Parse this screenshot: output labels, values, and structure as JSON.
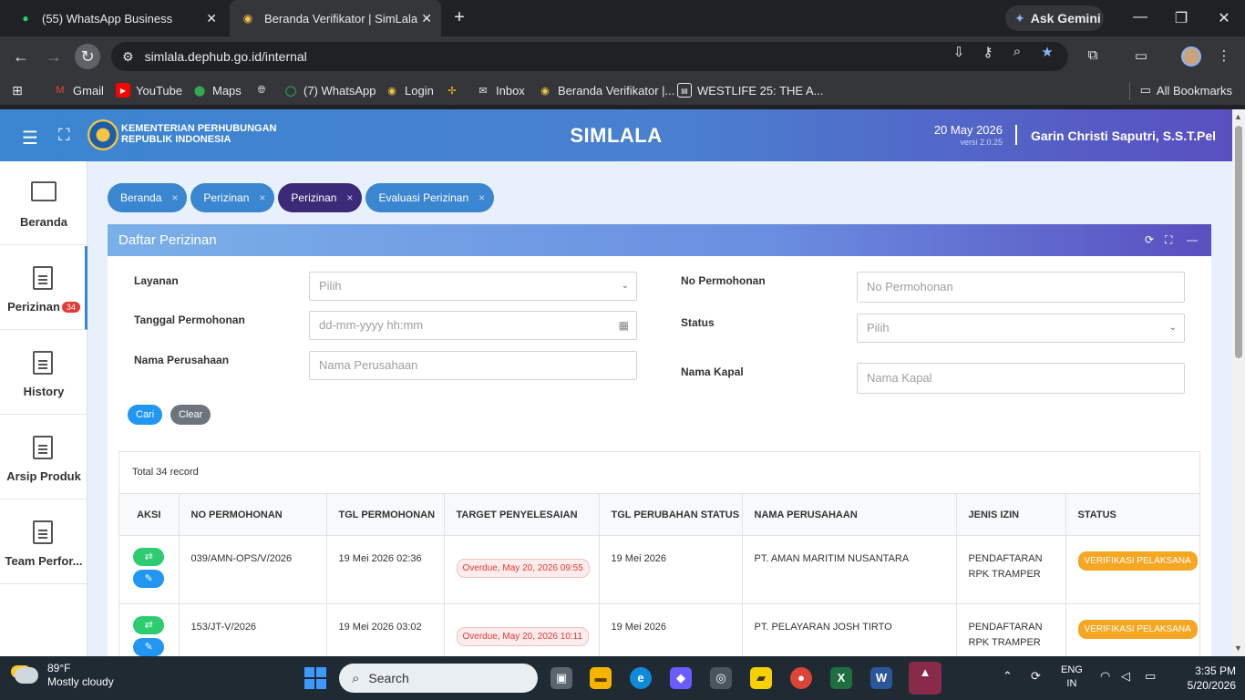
{
  "browser": {
    "tabs": [
      {
        "title": "(55) WhatsApp Business",
        "icon": "whatsapp-icon"
      },
      {
        "title": "Beranda Verifikator | SimLala",
        "icon": "ministry-logo-icon"
      }
    ],
    "ask_gemini": "Ask Gemini",
    "url": "simlala.dephub.go.id/internal",
    "bookmarks": [
      {
        "label": "Gmail",
        "icon": "gmail-icon"
      },
      {
        "label": "YouTube",
        "icon": "youtube-icon"
      },
      {
        "label": "Maps",
        "icon": "maps-icon"
      },
      {
        "label": "",
        "icon": "globe-icon"
      },
      {
        "label": "(7) WhatsApp",
        "icon": "whatsapp-icon"
      },
      {
        "label": "Login",
        "icon": "ministry-logo-icon"
      },
      {
        "label": "",
        "icon": "pinwheel-icon"
      },
      {
        "label": "Inbox",
        "icon": "mail-icon"
      },
      {
        "label": "Beranda Verifikator |...",
        "icon": "ministry-logo-icon"
      },
      {
        "label": "WESTLIFE 25: THE A...",
        "icon": "page-icon"
      }
    ],
    "all_bookmarks": "All Bookmarks"
  },
  "app": {
    "ministry_line1": "KEMENTERIAN PERHUBUNGAN",
    "ministry_line2": "REPUBLIK INDONESIA",
    "name": "SIMLALA",
    "date": "20 May 2026",
    "version": "versi 2.0.25",
    "user": "Garin Christi Saputri, S.S.T.Pel"
  },
  "sidebar": {
    "items": [
      {
        "label": "Beranda",
        "icon": "monitor-icon"
      },
      {
        "label": "Perizinan",
        "icon": "document-icon",
        "badge": "34"
      },
      {
        "label": "History",
        "icon": "document-icon"
      },
      {
        "label": "Arsip Produk",
        "icon": "document-icon"
      },
      {
        "label": "Team Perfor...",
        "icon": "document-icon"
      }
    ]
  },
  "breadcrumbs": [
    "Beranda",
    "Perizinan",
    "Perizinan",
    "Evaluasi Perizinan"
  ],
  "panel": {
    "title": "Daftar Perizinan",
    "filters": {
      "layanan_label": "Layanan",
      "layanan_value": "Pilih",
      "tanggal_label": "Tanggal Permohonan",
      "tanggal_placeholder": "dd-mm-yyyy hh:mm",
      "perusahaan_label": "Nama Perusahaan",
      "perusahaan_placeholder": "Nama Perusahaan",
      "no_label": "No Permohonan",
      "no_placeholder": "No Permohonan",
      "status_label": "Status",
      "status_value": "Pilih",
      "kapal_label": "Nama Kapal",
      "kapal_placeholder": "Nama Kapal"
    },
    "cari": "Cari",
    "clear": "Clear",
    "total": "Total 34 record",
    "columns": [
      "AKSI",
      "NO PERMOHONAN",
      "TGL PERMOHONAN",
      "TARGET PENYELESAIAN",
      "TGL PERUBAHAN STATUS",
      "NAMA PERUSAHAAN",
      "JENIS IZIN",
      "STATUS"
    ],
    "rows": [
      {
        "no": "039/AMN-OPS/V/2026",
        "tgl": "19 Mei 2026 02:36",
        "target": "Overdue, May 20, 2026 09:55",
        "perubahan": "19 Mei 2026",
        "perusahaan": "PT. AMAN MARITIM NUSANTARA",
        "jenis_line1": "PENDAFTARAN",
        "jenis_line2": "RPK TRAMPER",
        "status": "VERIFIKASI PELAKSANA"
      },
      {
        "no": "153/JT-V/2026",
        "tgl": "19 Mei 2026 03:02",
        "target": "Overdue, May 20, 2026 10:11",
        "perubahan": "19 Mei 2026",
        "perusahaan": "PT. PELAYARAN JOSH TIRTO",
        "jenis_line1": "PENDAFTARAN",
        "jenis_line2": "RPK TRAMPER",
        "status": "VERIFIKASI PELAKSANA"
      }
    ]
  },
  "taskbar": {
    "temp": "89°F",
    "weather": "Mostly cloudy",
    "search": "Search",
    "lang1": "ENG",
    "lang2": "IN",
    "time": "3:35 PM",
    "date": "5/20/2026"
  },
  "colors": {
    "accent": "#3a86d0",
    "active_crumb": "#3b2a78",
    "status": "#f5a623",
    "overdue": "#e53935"
  }
}
